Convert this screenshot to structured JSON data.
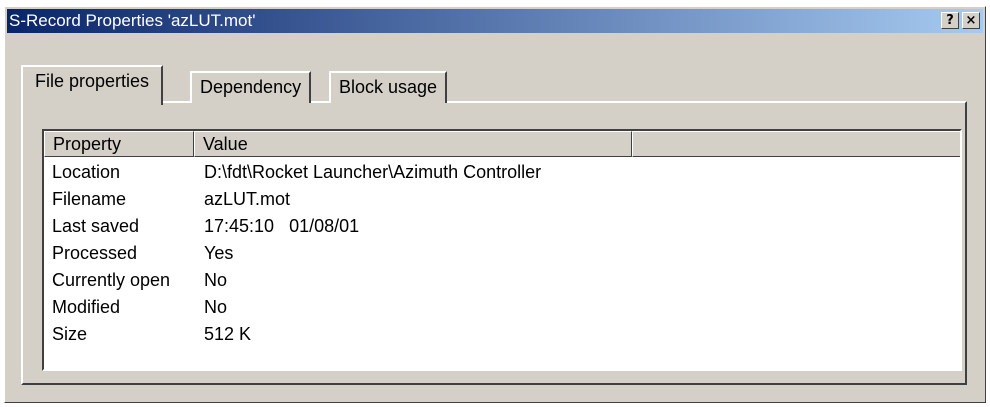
{
  "window": {
    "title": "S-Record Properties 'azLUT.mot'",
    "help_button": "?",
    "close_button": "×"
  },
  "tabs": [
    {
      "label": "File properties",
      "active": true
    },
    {
      "label": "Dependency",
      "active": false
    },
    {
      "label": "Block usage",
      "active": false
    }
  ],
  "table": {
    "columns": [
      "Property",
      "Value",
      ""
    ],
    "rows": [
      {
        "property": "Location",
        "value": "D:\\fdt\\Rocket Launcher\\Azimuth Controller"
      },
      {
        "property": "Filename",
        "value": "azLUT.mot"
      },
      {
        "property": "Last saved",
        "value": "17:45:10   01/08/01"
      },
      {
        "property": "Processed",
        "value": "Yes"
      },
      {
        "property": "Currently open",
        "value": "No"
      },
      {
        "property": "Modified",
        "value": "No"
      },
      {
        "property": "Size",
        "value": "512 K"
      }
    ]
  },
  "colors": {
    "title_bar_start": "#0a246a",
    "title_bar_end": "#a6caf0",
    "dialog_face": "#d4d0c8"
  }
}
